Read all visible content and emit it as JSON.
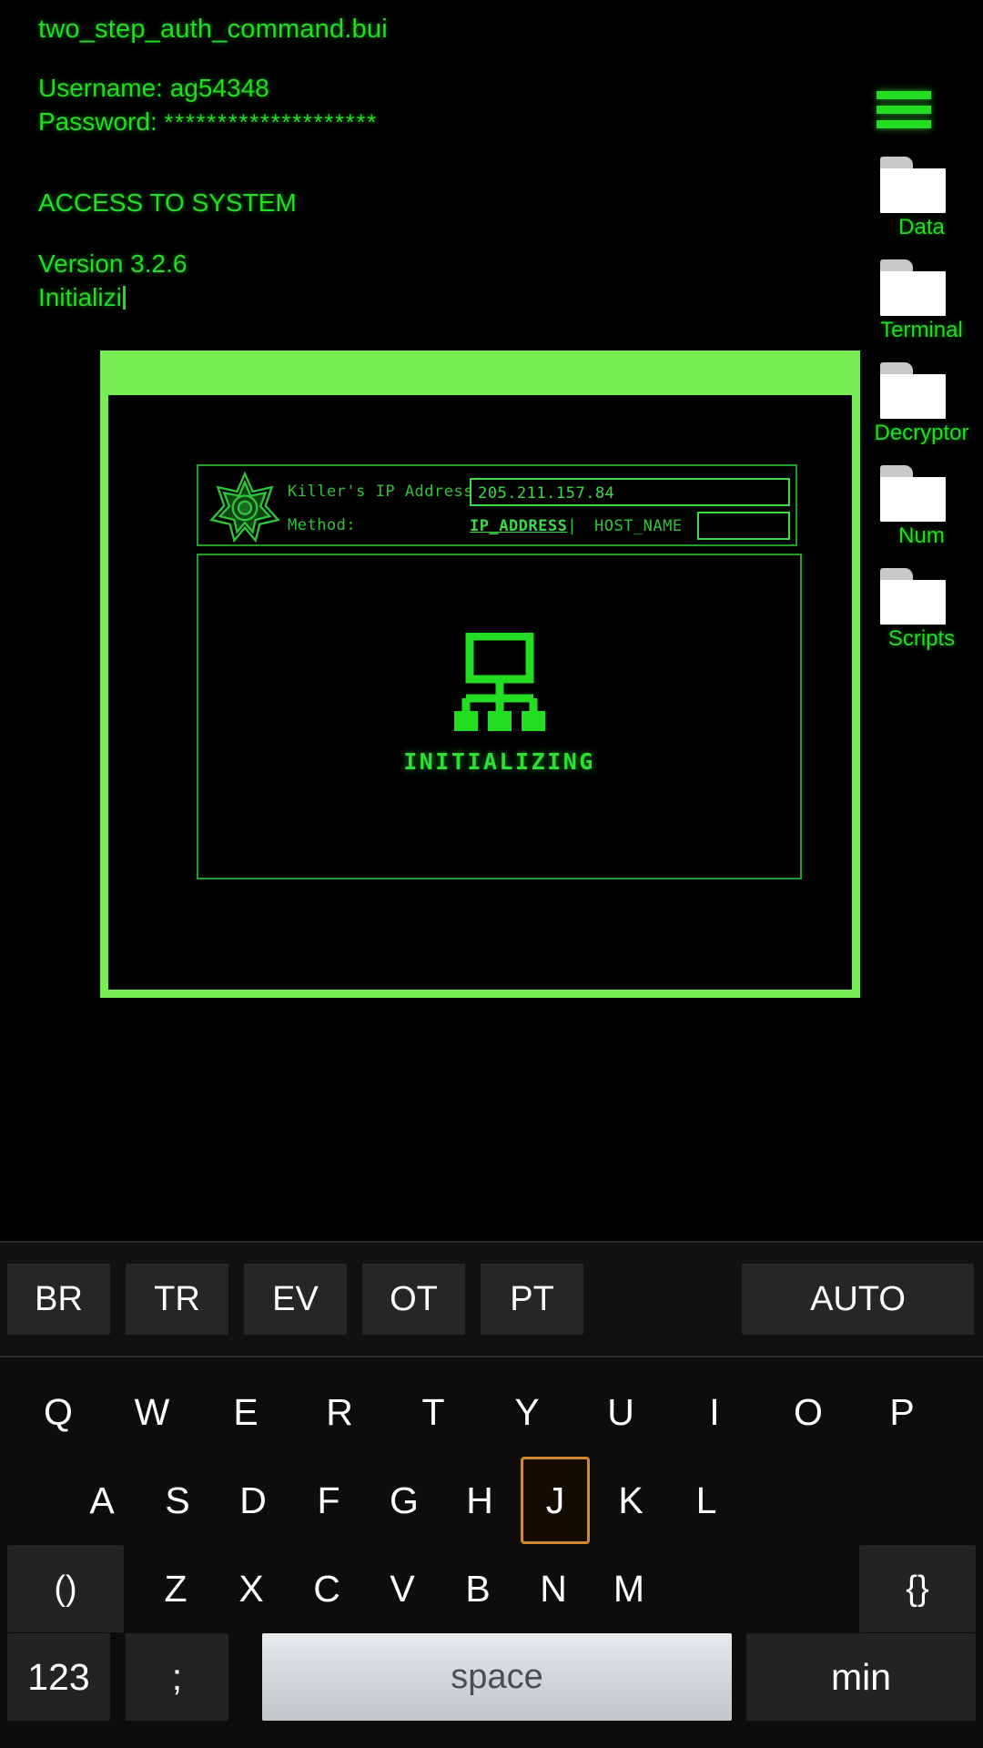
{
  "console": {
    "file_name": "two_step_auth_command.bui",
    "username_label": "Username:",
    "username_value": "ag54348",
    "password_label": "Password:",
    "password_value": "********************",
    "access_line": "ACCESS TO SYSTEM",
    "version_line": "Version 3.2.6",
    "status_line": "Initializi"
  },
  "sidebar": {
    "menu_icon": "hamburger-menu-icon",
    "folders": [
      {
        "label": "Data",
        "icon": "folder-icon"
      },
      {
        "label": "Terminal",
        "icon": "folder-icon"
      },
      {
        "label": "Decryptor",
        "icon": "folder-icon"
      },
      {
        "label": "Num",
        "icon": "folder-icon"
      },
      {
        "label": "Scripts",
        "icon": "folder-icon"
      }
    ]
  },
  "hack_window": {
    "emblem_icon": "star-badge-emblem-icon",
    "ip_label": "Killer's IP Address:",
    "ip_value": "205.211.157.84",
    "method_label": "Method:",
    "method_ip_option": "IP_ADDRESS",
    "method_divider": "|",
    "method_host_option": "HOST_NAME",
    "host_value": "",
    "host_placeholder": "",
    "network_icon": "network-hierarchy-icon",
    "status_text": "INITIALIZING"
  },
  "keyboard": {
    "suggestions": [
      "BR",
      "TR",
      "EV",
      "OT",
      "PT"
    ],
    "auto_label": "AUTO",
    "row1": [
      "Q",
      "W",
      "E",
      "R",
      "T",
      "Y",
      "U",
      "I",
      "O",
      "P"
    ],
    "row2": [
      "A",
      "S",
      "D",
      "F",
      "G",
      "H",
      "J",
      "K",
      "L"
    ],
    "row2_highlight": "J",
    "row3_left": "()",
    "row3": [
      "Z",
      "X",
      "C",
      "V",
      "B",
      "N",
      "M"
    ],
    "row3_right": "{}",
    "row4": {
      "numeric": "123",
      "semicolon": ";",
      "space": "space",
      "min": "min"
    }
  },
  "colors": {
    "terminal_green": "#22DD22",
    "window_border_green": "#76EE54",
    "panel_border_green": "#1f9e28",
    "highlight_amber": "#cf8a2b",
    "keyboard_bg": "#0d0d0d"
  }
}
